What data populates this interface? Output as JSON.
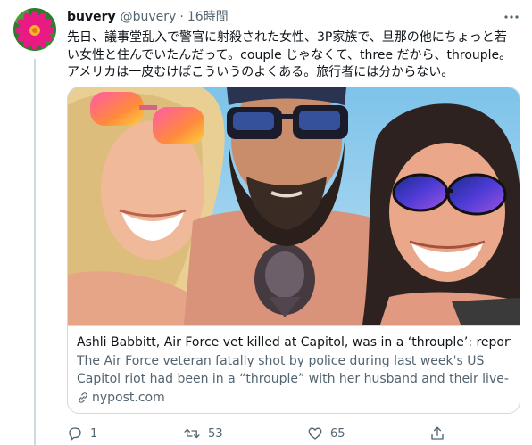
{
  "tweet": {
    "display_name": "buvery",
    "handle": "@buvery",
    "separator": "·",
    "time": "16時間",
    "text": "先日、議事堂乱入で警官に射殺された女性、3P家族で、旦那の他にちょっと若い女性と住んでいたんだって。couple じゃなくて、three だから、throuple。アメリカは一皮むけばこういうのよくある。旅行者には分からない。"
  },
  "card": {
    "title": "Ashli Babbitt, Air Force vet killed at Capitol, was in a ‘throuple’: reports",
    "description": "The Air Force veteran fatally shot by police during last week's US Capitol riot had been in a “throuple” with her husband and their live-i...",
    "domain": "nypost.com"
  },
  "actions": {
    "reply_count": "1",
    "retweet_count": "53",
    "like_count": "65"
  },
  "icons": {
    "avatar": "pink-flower-avatar",
    "more": "more-options-icon",
    "link": "link-icon",
    "reply": "reply-icon",
    "retweet": "retweet-icon",
    "like": "like-icon",
    "share": "share-icon"
  },
  "colors": {
    "text_primary": "#0f1419",
    "text_secondary": "#536471",
    "border": "#cfd9de",
    "avatar_flower": "#e8157f"
  }
}
